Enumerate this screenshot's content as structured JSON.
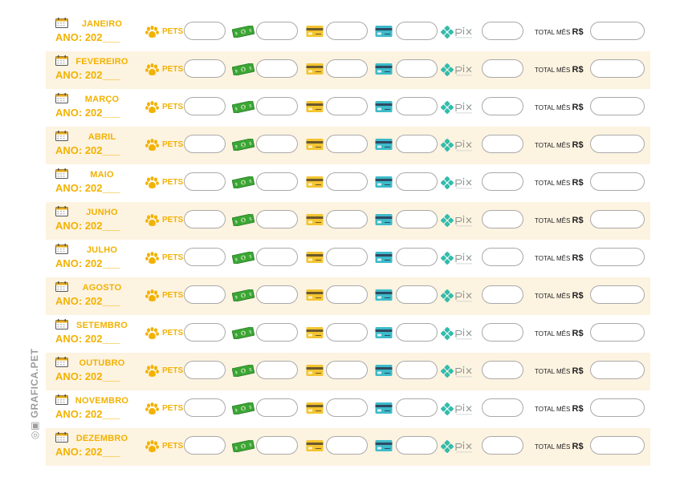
{
  "labels": {
    "year": "ANO: 202___",
    "pets": "PETS",
    "total": "TOTAL MÊS",
    "currency": "R$"
  },
  "months": [
    "JANEIRO",
    "FEVEREIRO",
    "MARÇO",
    "ABRIL",
    "MAIO",
    "JUNHO",
    "JULHO",
    "AGOSTO",
    "SETEMBRO",
    "OUTUBRO",
    "NOVEMBRO",
    "DEZEMBRO"
  ],
  "watermark": "GRAFICA.PET",
  "icons": {
    "calendar": "calendar-icon",
    "pets": "paw-icon",
    "cash": "cash-icon",
    "credit": "credit-card-icon",
    "debit": "debit-card-icon",
    "pix": "pix-logo"
  },
  "colors": {
    "accent": "#f2b200",
    "row_alt": "#fdf3e1",
    "pix": "#32bcad",
    "cash": "#3aa635"
  }
}
